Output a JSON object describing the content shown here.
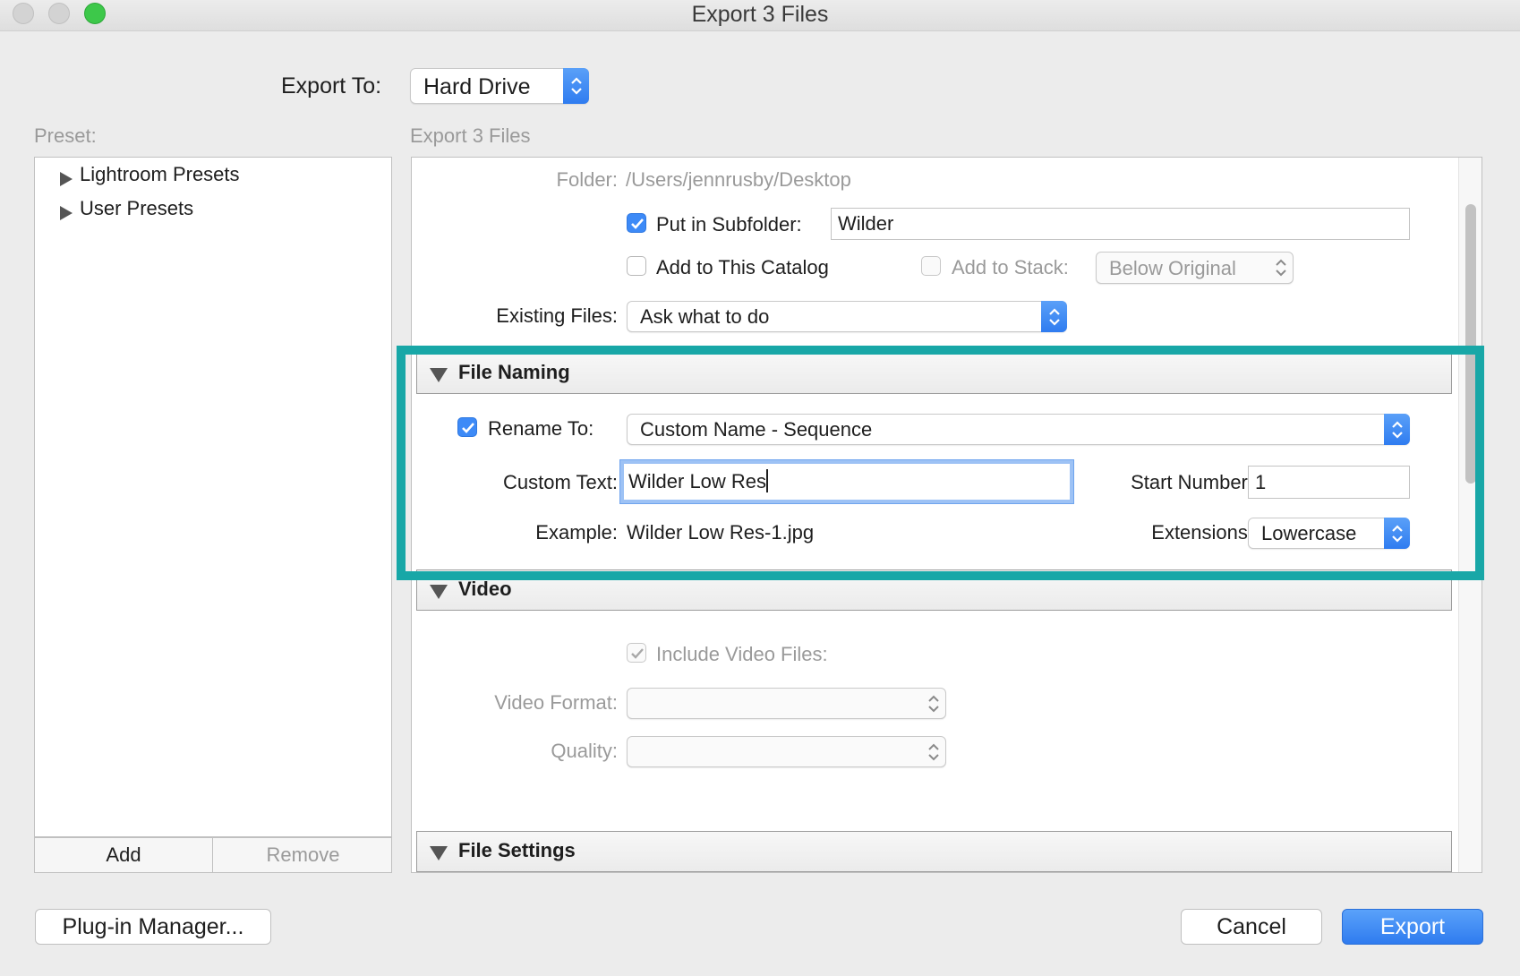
{
  "window": {
    "title": "Export 3 Files"
  },
  "export_to": {
    "label": "Export To:",
    "value": "Hard Drive"
  },
  "preset": {
    "label": "Preset:",
    "items": [
      {
        "label": "Lightroom Presets"
      },
      {
        "label": "User Presets"
      }
    ],
    "add_label": "Add",
    "remove_label": "Remove"
  },
  "main_header": "Export 3 Files",
  "export_location": {
    "folder_label": "Folder:",
    "folder_value": "/Users/jennrusby/Desktop",
    "subfolder_label": "Put in Subfolder:",
    "subfolder_checked": true,
    "subfolder_value": "Wilder",
    "catalog_label": "Add to This Catalog",
    "catalog_checked": false,
    "stack_label": "Add to Stack:",
    "stack_checked": false,
    "stack_value": "Below Original",
    "existing_label": "Existing Files:",
    "existing_value": "Ask what to do"
  },
  "file_naming": {
    "title": "File Naming",
    "rename_label": "Rename To:",
    "rename_checked": true,
    "rename_value": "Custom Name - Sequence",
    "custom_text_label": "Custom Text:",
    "custom_text_value": "Wilder Low Res",
    "start_number_label": "Start Number:",
    "start_number_value": "1",
    "example_label": "Example:",
    "example_value": "Wilder Low Res-1.jpg",
    "extensions_label": "Extensions:",
    "extensions_value": "Lowercase"
  },
  "video": {
    "title": "Video",
    "include_label": "Include Video Files:",
    "include_checked": true,
    "format_label": "Video Format:",
    "format_value": "",
    "quality_label": "Quality:",
    "quality_value": ""
  },
  "file_settings": {
    "title": "File Settings"
  },
  "footer": {
    "plugin_label": "Plug-in Manager...",
    "cancel_label": "Cancel",
    "export_label": "Export"
  },
  "colors": {
    "accent": "#3d8af7",
    "highlight": "#18a7a7"
  }
}
